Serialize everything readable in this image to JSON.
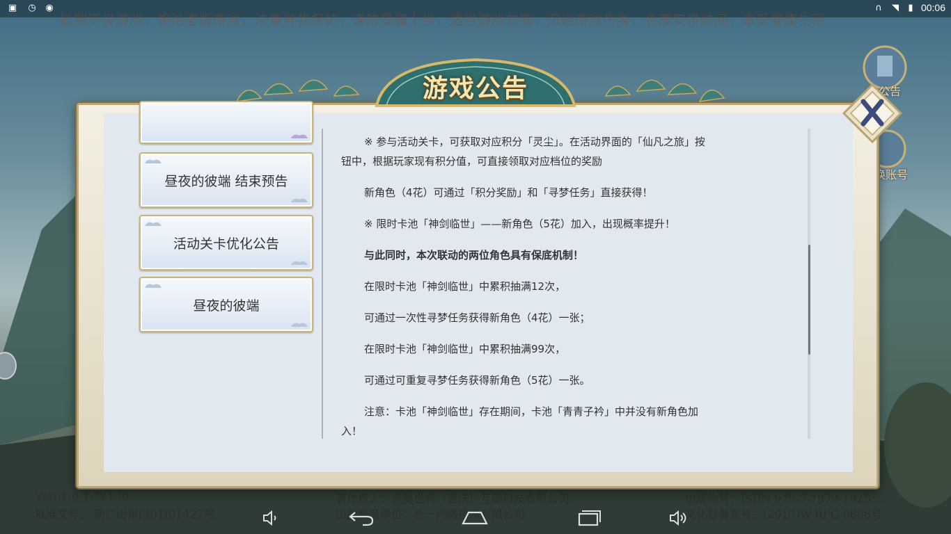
{
  "status_bar": {
    "time": "00:06",
    "left_icons": [
      "image-icon",
      "timer-icon",
      "chat-icon"
    ],
    "right_icons": [
      "headphones-icon",
      "wifi-icon",
      "battery-icon"
    ]
  },
  "health_notice": "抵制不良游戏，拒绝盗版游戏，注意自我保护，谨防受骗上当，适当游戏益脑，沉迷游戏伤身，合理安排时间，享受健康生活",
  "bottom_info": {
    "version": "Ver: 1.6.1.72130",
    "approval": "批准文号： 新广出审[2016]1427号",
    "copyright": "著作权人：完美世界（重庆）互动科技有限公司",
    "publisher": "出版服务单位：合一网络技术有限公司",
    "isbn": "出版物号：ISBN 978-7-7979-1925",
    "culture": "文化部备案号：[2017]W-RPG 0686号"
  },
  "side_buttons": {
    "announce_label": "公告",
    "switch_account_label": "换账号"
  },
  "dialog": {
    "title": "游戏公告",
    "list_items": [
      {
        "label": ""
      },
      {
        "label": "昼夜的彼端 结束预告"
      },
      {
        "label": "活动关卡优化公告"
      },
      {
        "label": "昼夜的彼端"
      }
    ],
    "content": [
      {
        "text": "※ 参与活动关卡，可获取对应积分「灵尘」。在活动界面的「仙凡之旅」按钮中，根据玩家现有积分值，可直接领取对应档位的奖励",
        "bold": false
      },
      {
        "text": "新角色（4花）可通过「积分奖励」和「寻梦任务」直接获得！",
        "bold": false
      },
      {
        "text": "※ 限时卡池「神剑临世」——新角色（5花）加入，出现概率提升！",
        "bold": false
      },
      {
        "text": "与此同时，本次联动的两位角色具有保底机制！",
        "bold": true
      },
      {
        "text": "在限时卡池「神剑临世」中累积抽满12次，",
        "bold": false
      },
      {
        "text": "可通过一次性寻梦任务获得新角色（4花）一张；",
        "bold": false
      },
      {
        "text": "在限时卡池「神剑临世」中累积抽满99次，",
        "bold": false
      },
      {
        "text": "可通过可重复寻梦任务获得新角色（5花）一张。",
        "bold": false
      },
      {
        "text": "注意：卡池「神剑临世」存在期间，卡池「青青子衿」中并没有新角色加入！",
        "bold": false
      }
    ]
  },
  "nav": [
    "volume-down-icon",
    "back-icon",
    "home-icon",
    "recents-icon",
    "volume-up-icon"
  ]
}
